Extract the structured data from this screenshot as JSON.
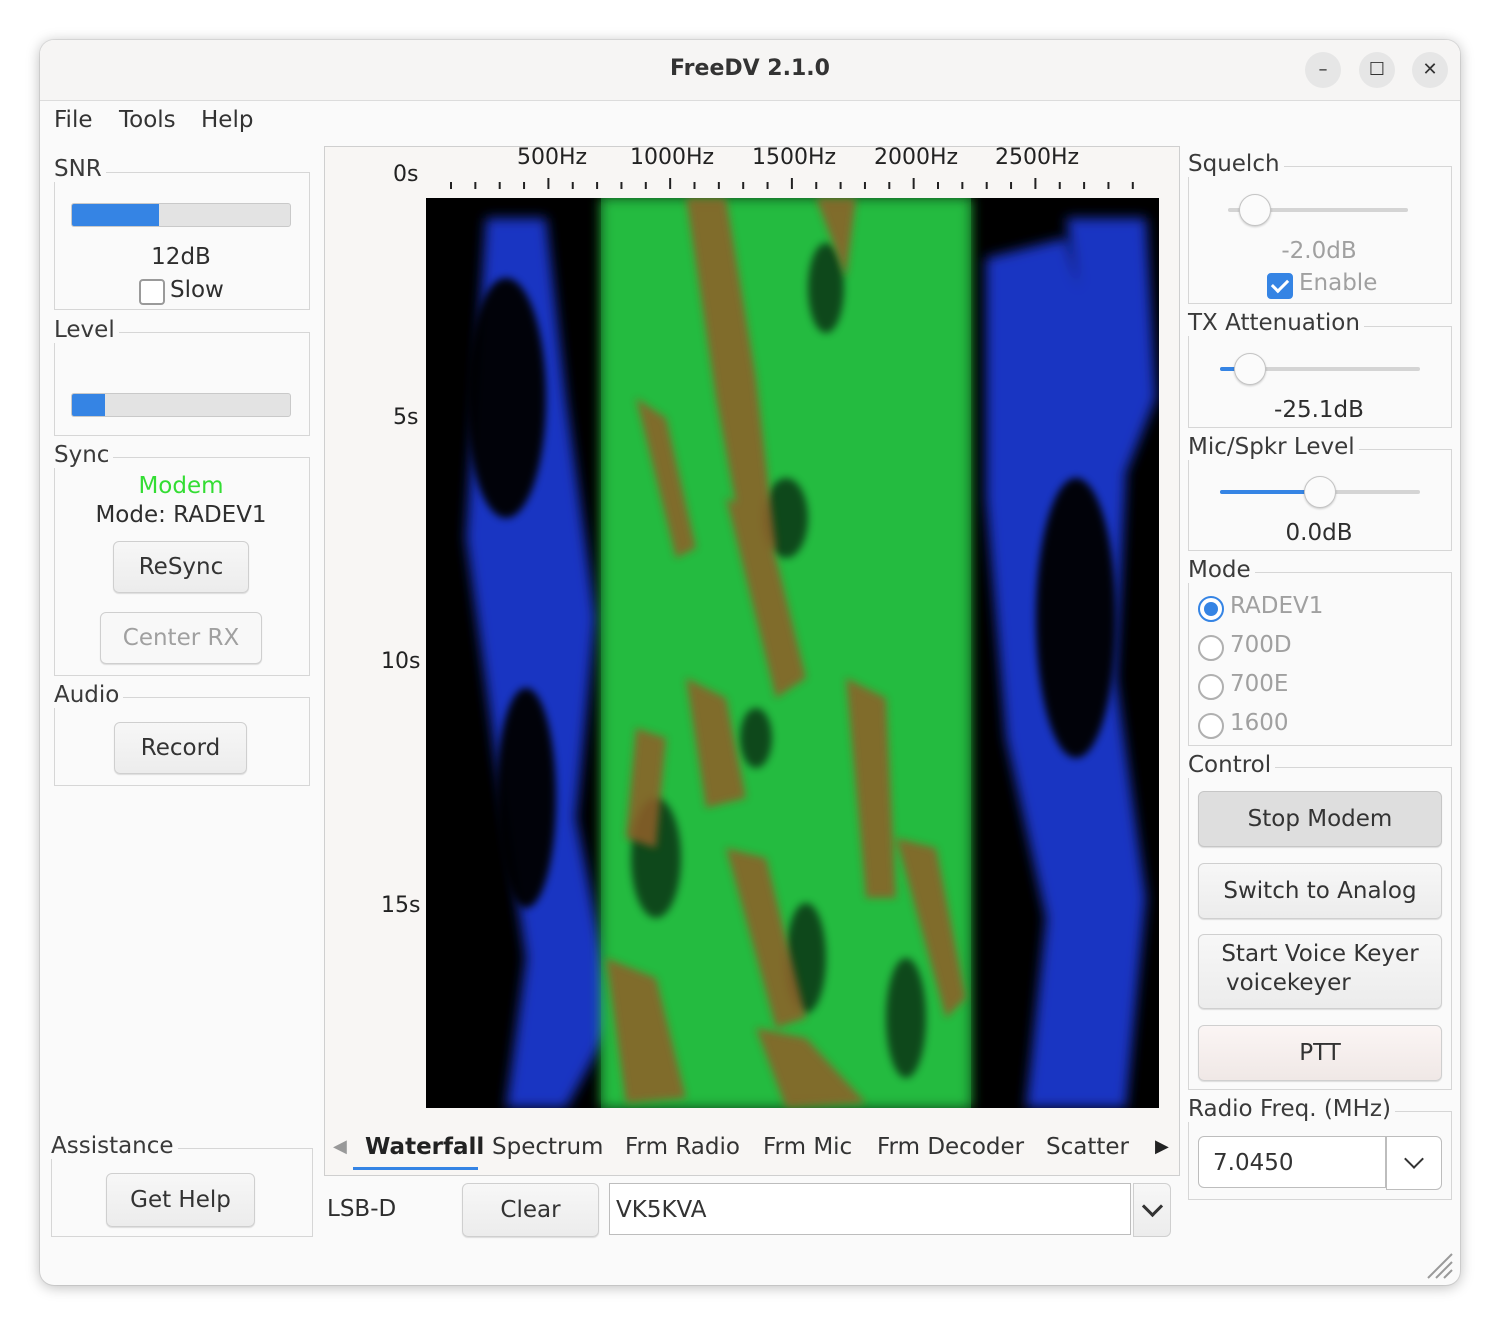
{
  "window": {
    "title": "FreeDV 2.1.0",
    "controls": {
      "minimize": "–",
      "maximize": "☐",
      "close": "✕"
    }
  },
  "menu": {
    "items": [
      "File",
      "Tools",
      "Help"
    ]
  },
  "left": {
    "snr": {
      "label": "SNR",
      "value": "12dB",
      "level": 0.4,
      "slow_label": "Slow",
      "slow_checked": false
    },
    "level": {
      "label": "Level",
      "level": 0.15
    },
    "sync": {
      "label": "Sync",
      "status": "Modem",
      "status_color": "#33dd33",
      "mode_text": "Mode: RADEV1",
      "resync_label": "ReSync",
      "center_rx_label": "Center RX"
    },
    "audio": {
      "label": "Audio",
      "record_label": "Record"
    },
    "assistance": {
      "label": "Assistance",
      "help_label": "Get Help"
    }
  },
  "plot": {
    "freq_ticks": [
      "500Hz",
      "1000Hz",
      "1500Hz",
      "2000Hz",
      "2500Hz"
    ],
    "time_ticks": [
      "0s",
      "5s",
      "10s",
      "15s"
    ],
    "tabs": [
      "Waterfall",
      "Spectrum",
      "Frm Radio",
      "Frm Mic",
      "Frm Decoder",
      "Scatter"
    ],
    "active_tab": "Waterfall"
  },
  "bottom": {
    "mode_text": "LSB-D",
    "clear_label": "Clear",
    "callsign_value": "VK5KVA"
  },
  "right": {
    "squelch": {
      "label": "Squelch",
      "value": "-2.0dB",
      "level": 0.15,
      "enable_label": "Enable",
      "enabled": true
    },
    "tx_atten": {
      "label": "TX Attenuation",
      "value": "-25.1dB",
      "level": 0.15
    },
    "mic_level": {
      "label": "Mic/Spkr Level",
      "value": "0.0dB",
      "level": 0.5
    },
    "mode": {
      "label": "Mode",
      "options": [
        "RADEV1",
        "700D",
        "700E",
        "1600"
      ],
      "selected": "RADEV1"
    },
    "control": {
      "label": "Control",
      "stop_modem": "Stop Modem",
      "switch_analog": "Switch to Analog",
      "voice_keyer": "Start Voice Keyer",
      "voice_keyer_file": "voicekeyer",
      "ptt": "PTT"
    },
    "radio_freq": {
      "label": "Radio Freq. (MHz)",
      "value": "7.0450"
    }
  }
}
